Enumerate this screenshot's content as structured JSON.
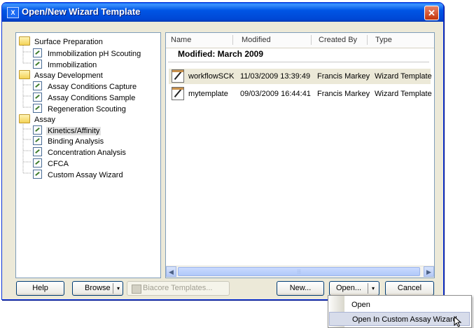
{
  "window": {
    "title": "Open/New Wizard Template",
    "close_symbol": "✕"
  },
  "tree": [
    {
      "label": "Surface Preparation",
      "kind": "folder"
    },
    {
      "label": "Immobilization pH Scouting",
      "kind": "template"
    },
    {
      "label": "Immobilization",
      "kind": "template"
    },
    {
      "label": "Assay Development",
      "kind": "folder"
    },
    {
      "label": "Assay Conditions Capture",
      "kind": "template"
    },
    {
      "label": "Assay Conditions Sample",
      "kind": "template"
    },
    {
      "label": "Regeneration Scouting",
      "kind": "template"
    },
    {
      "label": "Assay",
      "kind": "folder"
    },
    {
      "label": "Kinetics/Affinity",
      "kind": "template",
      "selected": true
    },
    {
      "label": "Binding Analysis",
      "kind": "template"
    },
    {
      "label": "Concentration Analysis",
      "kind": "template"
    },
    {
      "label": "CFCA",
      "kind": "template"
    },
    {
      "label": "Custom Assay Wizard",
      "kind": "template"
    }
  ],
  "list": {
    "columns": [
      "Name",
      "Modified",
      "Created By",
      "Type"
    ],
    "group_label": "Modified: March 2009",
    "rows": [
      {
        "name": "workflowSCK",
        "modified": "11/03/2009 13:39:49",
        "created_by": "Francis Markey",
        "type": "Wizard Template",
        "selected": true
      },
      {
        "name": "mytemplate",
        "modified": "09/03/2009 16:44:41",
        "created_by": "Francis Markey",
        "type": "Wizard Template",
        "selected": false
      }
    ],
    "scroll_left": "◀",
    "scroll_right": "▶",
    "scroll_grip": "⦙⦙⦙"
  },
  "buttons": {
    "help": "Help",
    "browse": "Browse",
    "biacore_templates": "Biacore Templates...",
    "new": "New...",
    "open": "Open...",
    "cancel": "Cancel",
    "dropdown_arrow": "▾"
  },
  "open_menu": {
    "items": [
      "Open",
      "Open In Custom Assay Wizard"
    ],
    "highlighted_index": 1
  }
}
